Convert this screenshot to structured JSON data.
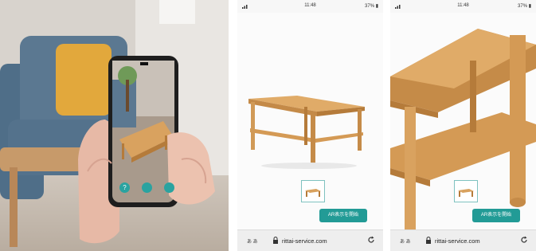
{
  "phone_screen": {
    "buttons": [
      {
        "label": "?",
        "color": "#2aa3a0"
      },
      {
        "label": "",
        "color": "#2aa3a0"
      },
      {
        "label": "",
        "color": "#2aa3a0"
      }
    ]
  },
  "screens": [
    {
      "status": {
        "time": "11:48",
        "battery": "37%"
      },
      "ar_button_label": "AR表示を開始",
      "url_bar": {
        "keyboard": "あ あ",
        "url": "rittai-service.com"
      }
    },
    {
      "status": {
        "time": "11:48",
        "battery": "37%"
      },
      "ar_button_label": "AR表示を開始",
      "url_bar": {
        "keyboard": "あ あ",
        "url": "rittai-service.com"
      }
    }
  ],
  "colors": {
    "accent": "#229b96",
    "wood": "#d9a25f",
    "wood_dark": "#b57b3a",
    "sofa": "#5b7891",
    "pillow": "#e2a83c"
  },
  "icons": [
    "signal-icon",
    "battery-icon",
    "lock-icon",
    "reload-icon"
  ]
}
